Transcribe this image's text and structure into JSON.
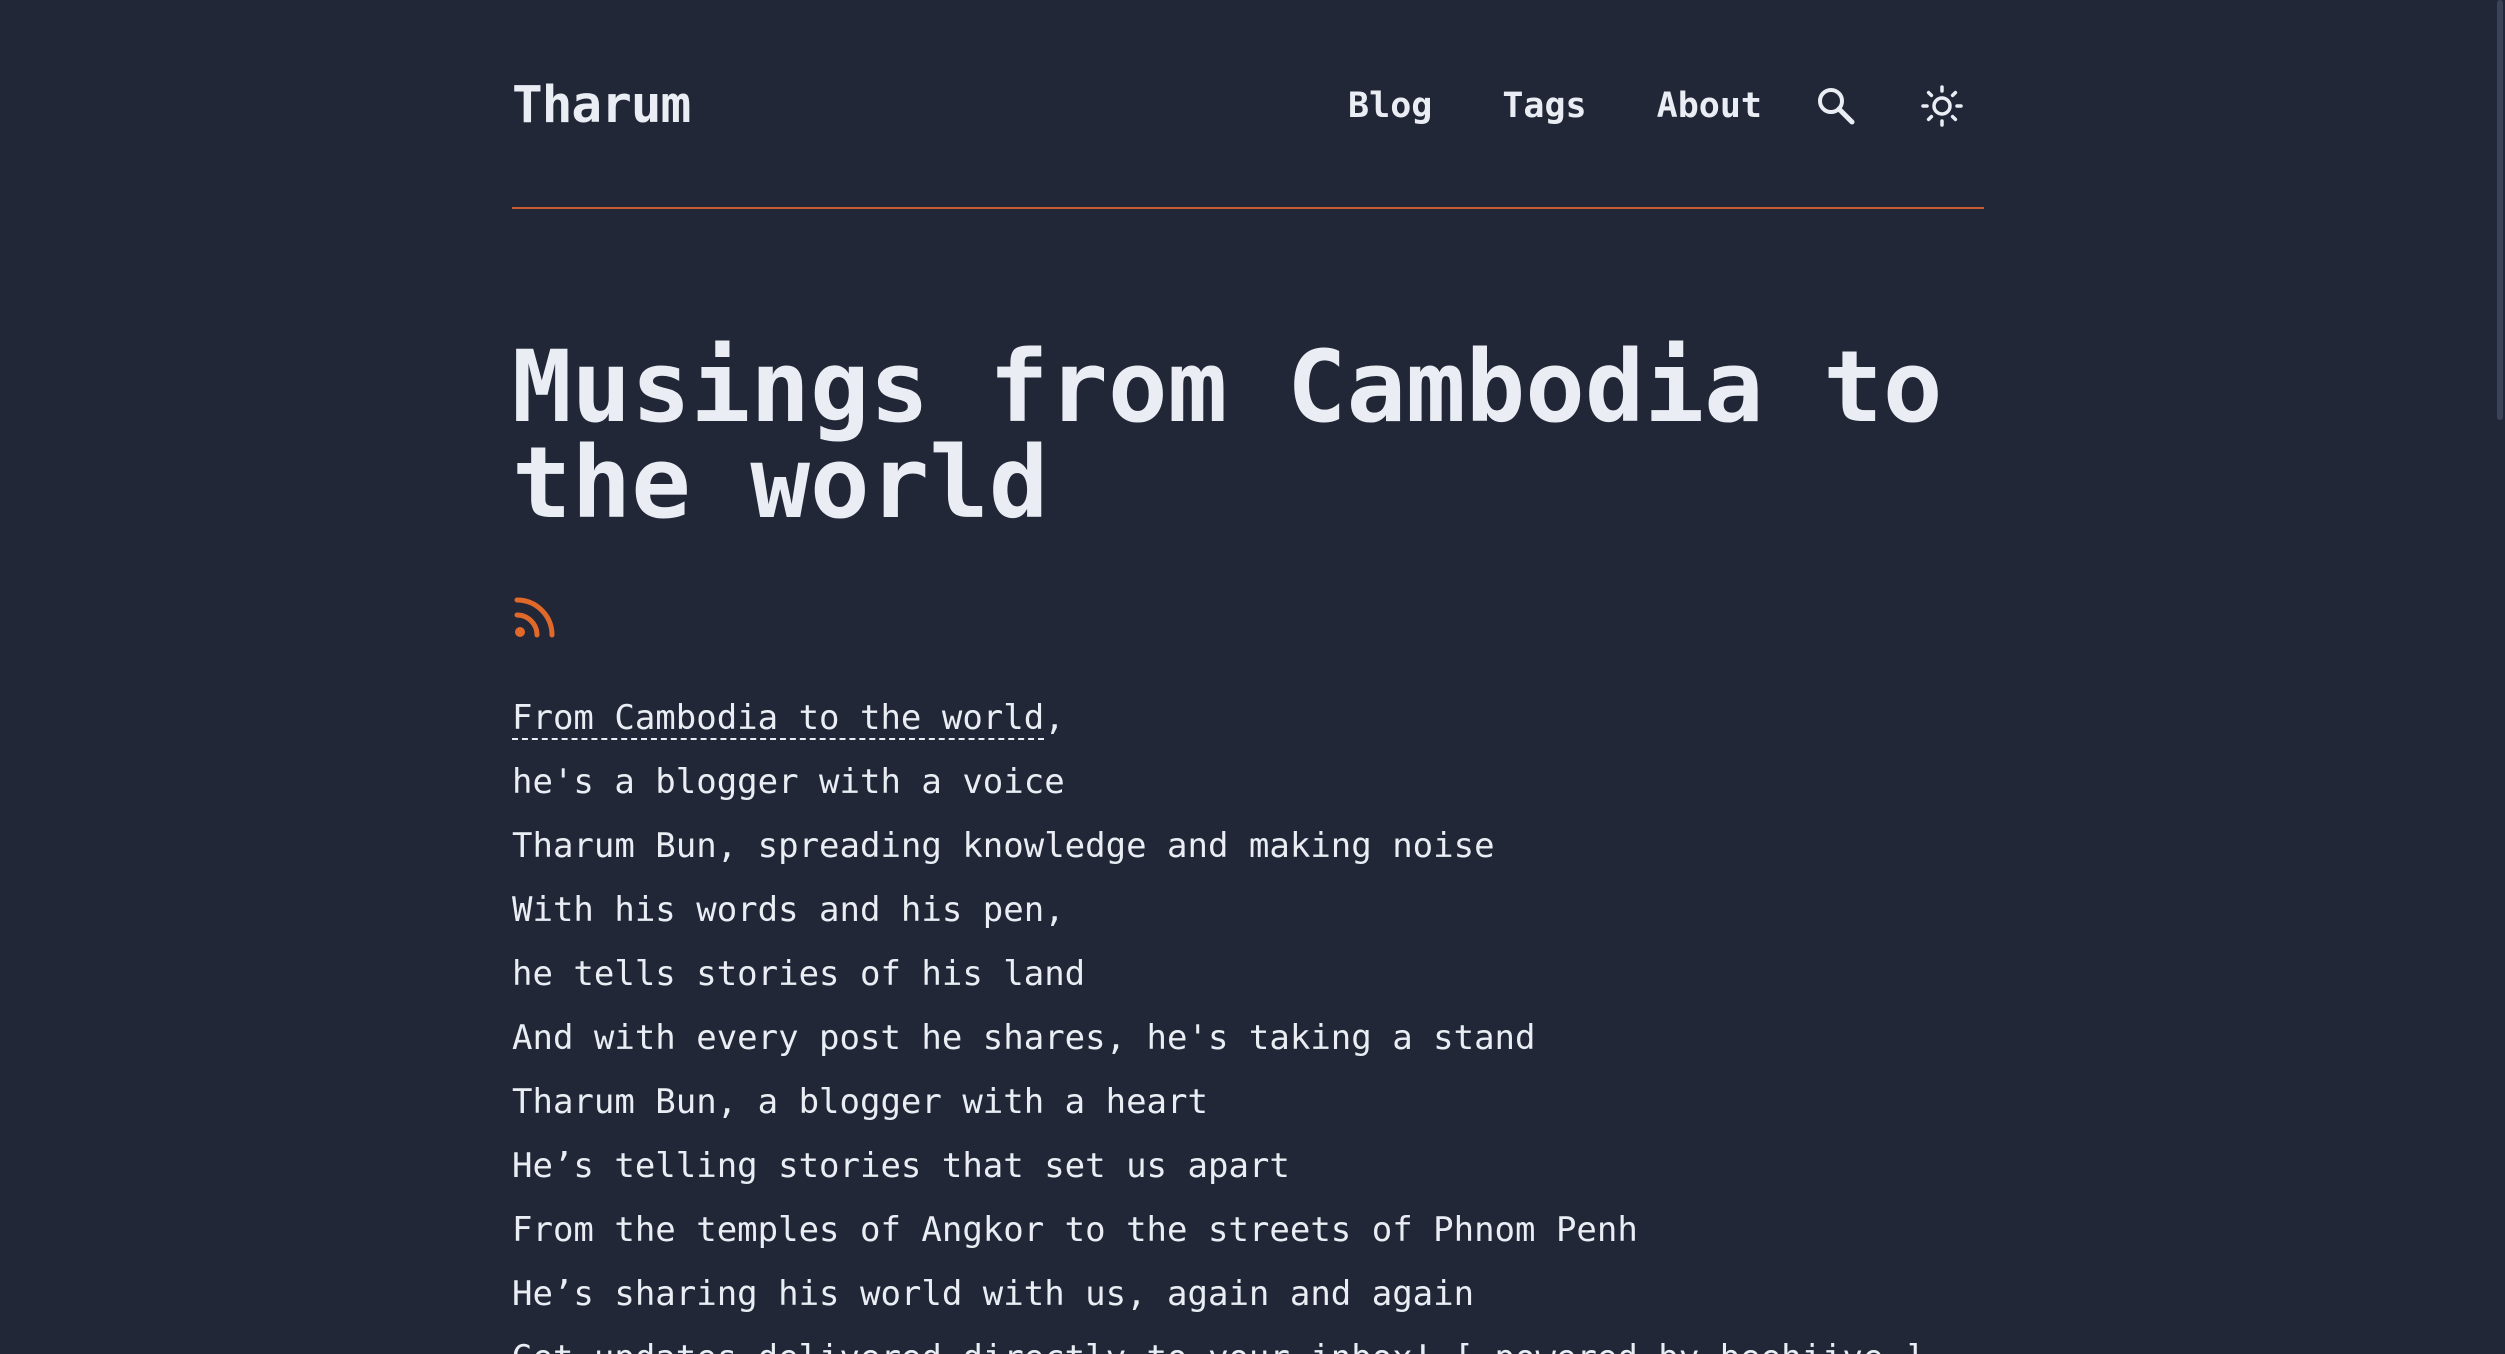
{
  "header": {
    "logo": "Tharum",
    "nav": {
      "blog": "Blog",
      "tags": "Tags",
      "about": "About"
    },
    "icons": {
      "search": "search-icon",
      "theme": "sun-icon"
    }
  },
  "hero": {
    "title": "Musings from Cambodia to the world",
    "rss_icon": "rss-icon",
    "intro_link": "From Cambodia to the world",
    "intro_suffix": ",",
    "lines": [
      "he's a blogger with a voice",
      "Tharum Bun, spreading knowledge and making noise",
      "With his words and his pen,",
      "he tells stories of his land",
      "And with every post he shares, he's taking a stand",
      "Tharum Bun, a blogger with a heart",
      "He’s telling stories that set us apart",
      "From the temples of Angkor to the streets of Phnom Penh",
      "He’s sharing his world with us, again and again",
      "Get updates delivered directly to your inbox! [ powered by beehiive ]"
    ]
  },
  "colors": {
    "background": "#212737",
    "text": "#eaedf3",
    "accent": "#e0692a"
  }
}
